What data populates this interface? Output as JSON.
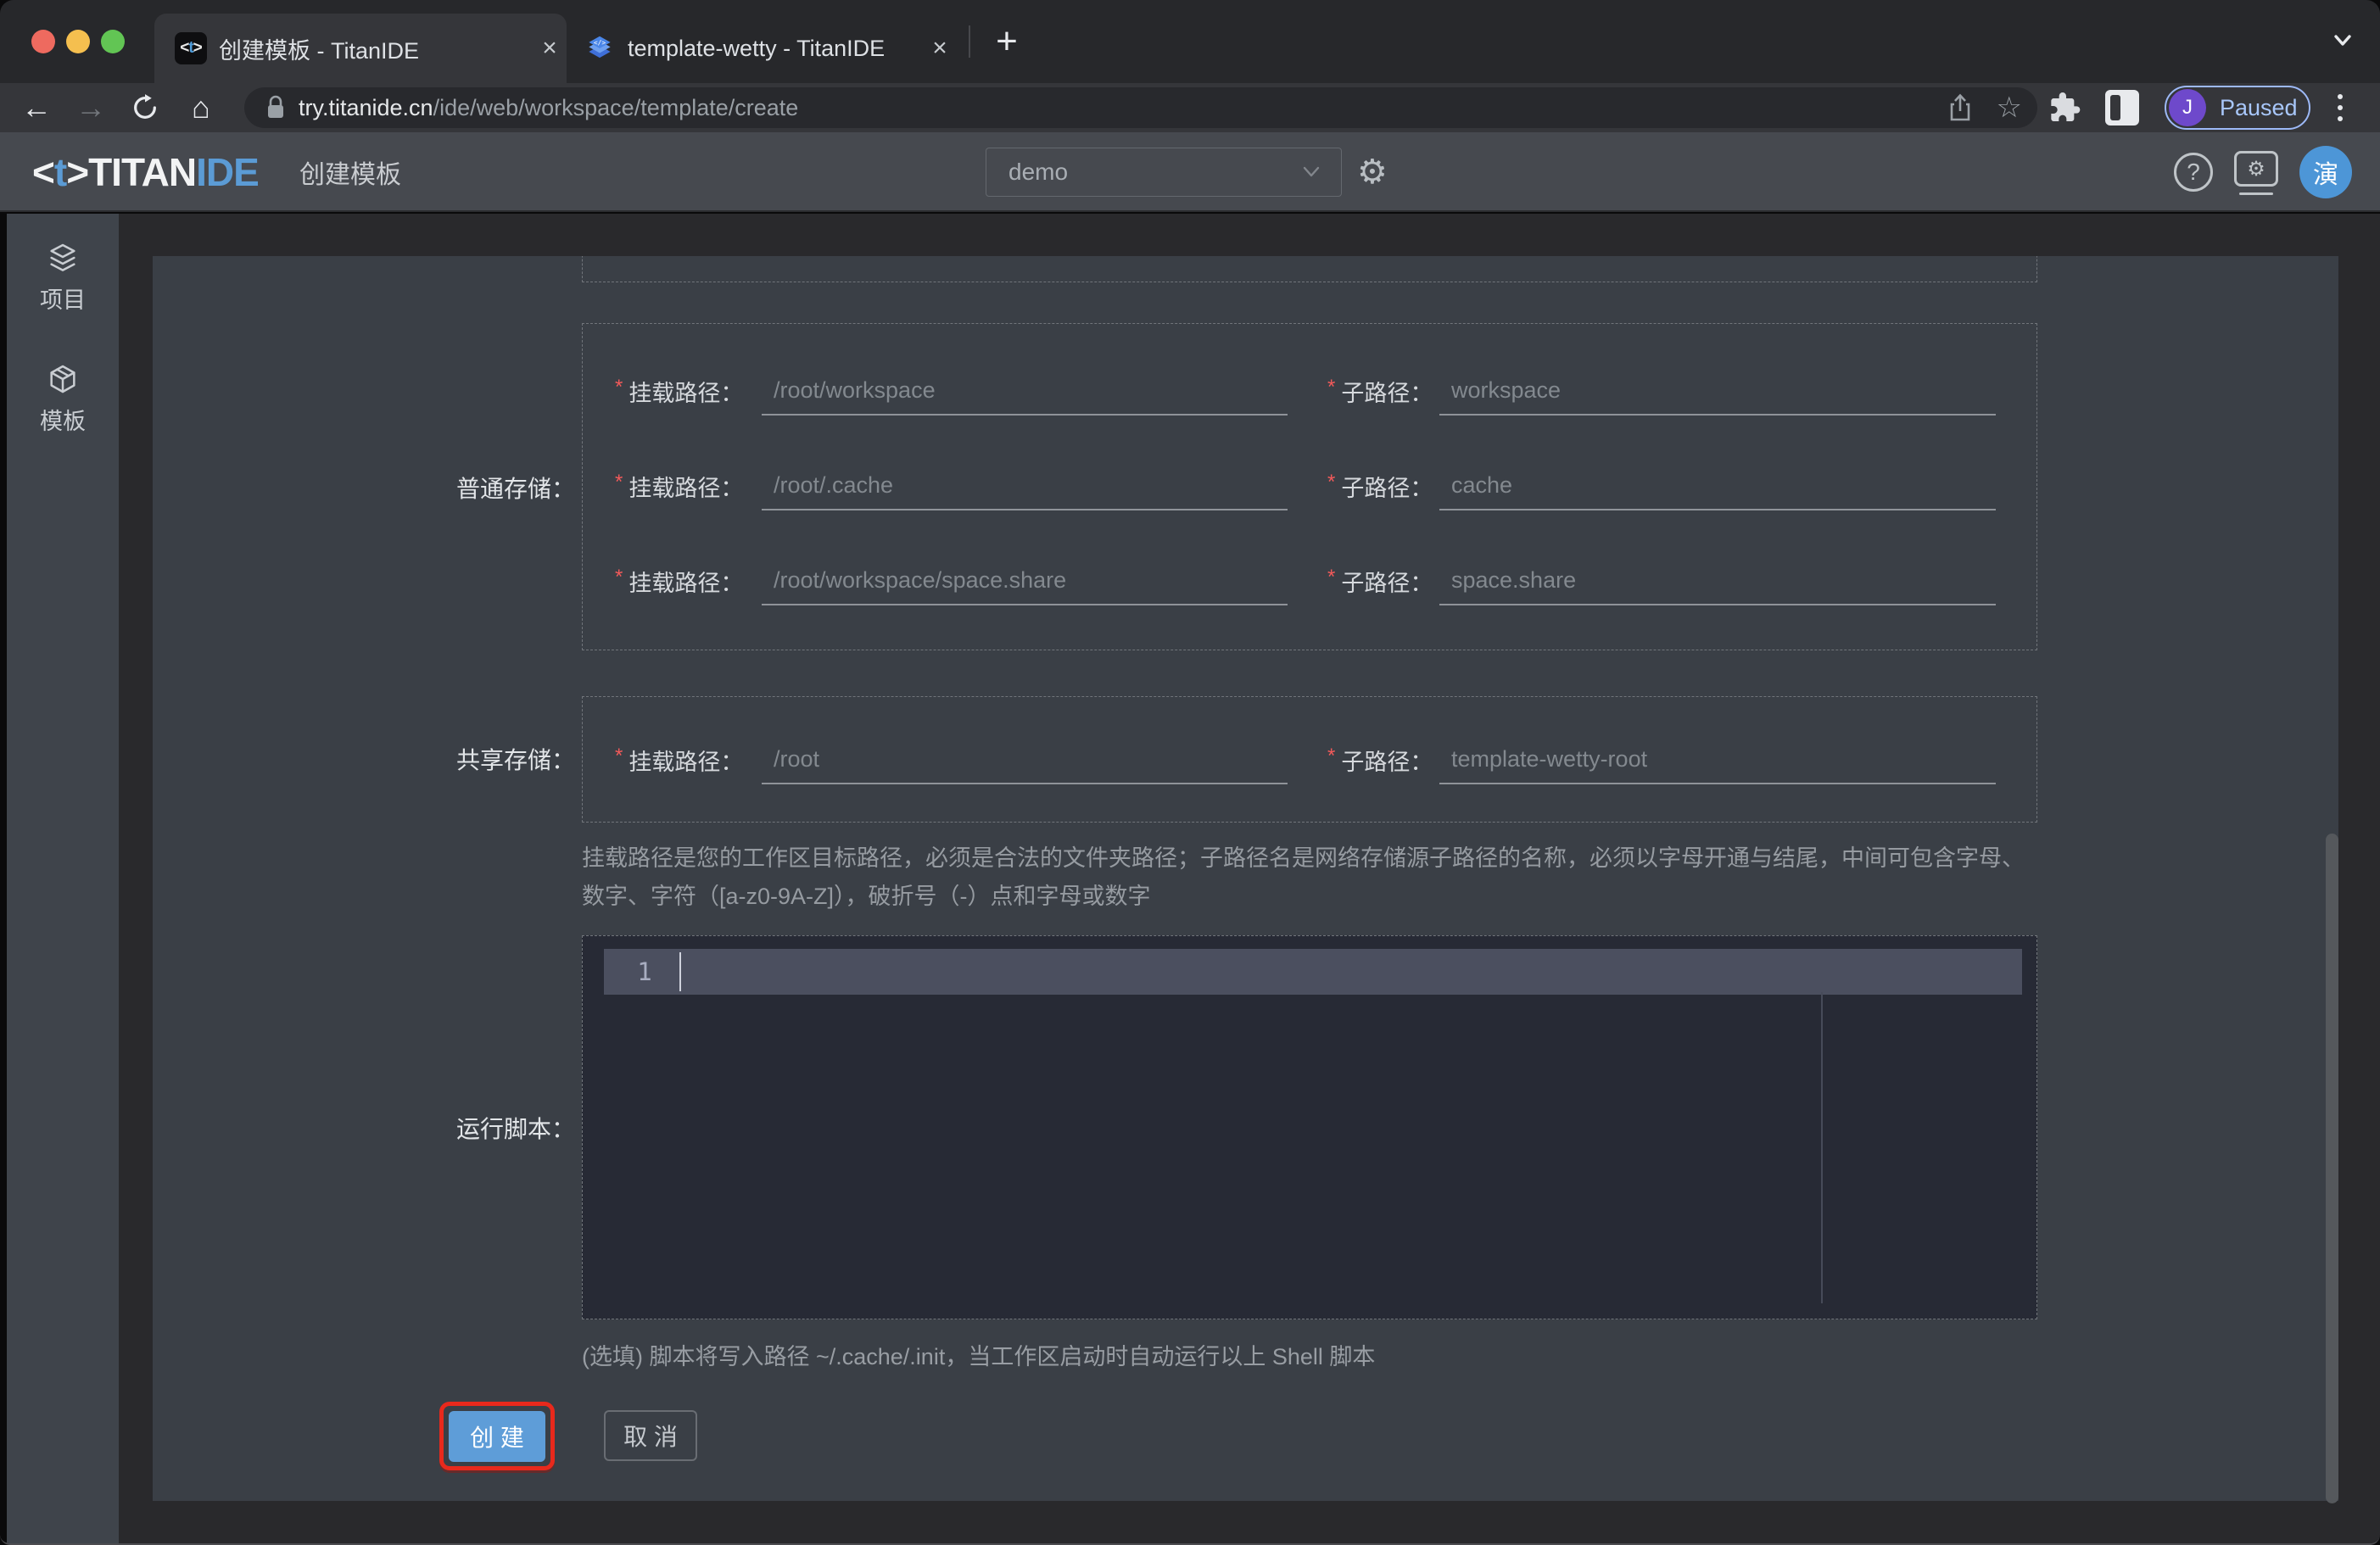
{
  "colors": {
    "brand_blue": "#5b9bd5",
    "primary_button": "#5e9dd8",
    "annotation_red": "#e8291c",
    "paused_text": "#a8c7fa",
    "profile_purple": "#6e49cb",
    "avatar_blue": "#4d96d7",
    "asterisk_red": "#f25a5a"
  },
  "browser": {
    "tabs": [
      {
        "title": "创建模板 - TitanIDE",
        "close": "×",
        "favicon_open": "<",
        "favicon_t": "t",
        "favicon_close": ">"
      },
      {
        "title": "template-wetty - TitanIDE",
        "close": "×"
      }
    ],
    "new_tab": "+",
    "toolbar": {
      "back": "←",
      "forward": "→",
      "home": "⌂",
      "url_host": "try.titanide.cn",
      "url_path": "/ide/web/workspace/template/create",
      "star": "☆",
      "profile_initial": "J",
      "profile_status": "Paused"
    }
  },
  "header": {
    "logo_open": "<",
    "logo_t": "t",
    "logo_close": ">",
    "logo_titan": "TITAN",
    "logo_ide": "IDE",
    "page_title": "创建模板",
    "workspace_value": "demo",
    "gear": "⚙",
    "help": "?",
    "sys_gear": "⚙",
    "avatar_text": "演"
  },
  "sidebar": {
    "items": [
      {
        "label": "项目"
      },
      {
        "label": "模板"
      }
    ]
  },
  "form": {
    "required_marker": "*",
    "sections": [
      {
        "label": "普通存储：",
        "rows": [
          {
            "mount_label": "挂载路径：",
            "mount_placeholder": "/root/workspace",
            "sub_label": "子路径：",
            "sub_placeholder": "workspace"
          },
          {
            "mount_label": "挂载路径：",
            "mount_placeholder": "/root/.cache",
            "sub_label": "子路径：",
            "sub_placeholder": "cache"
          },
          {
            "mount_label": "挂载路径：",
            "mount_placeholder": "/root/workspace/space.share",
            "sub_label": "子路径：",
            "sub_placeholder": "space.share"
          }
        ]
      },
      {
        "label": "共享存储：",
        "rows": [
          {
            "mount_label": "挂载路径：",
            "mount_placeholder": "/root",
            "sub_label": "子路径：",
            "sub_placeholder": "template-wetty-root"
          }
        ]
      }
    ],
    "help_text": "挂载路径是您的工作区目标路径，必须是合法的文件夹路径；子路径名是网络存储源子路径的名称，必须以字母开通与结尾，中间可包含字母、数字、字符（[a-z0-9A-Z]），破折号（-）点和字母或数字",
    "script_section": {
      "label": "运行脚本：",
      "line_number": "1",
      "note": "(选填) 脚本将写入路径 ~/.cache/.init，当工作区启动时自动运行以上 Shell 脚本"
    },
    "buttons": {
      "create": "创 建",
      "cancel": "取 消"
    }
  }
}
